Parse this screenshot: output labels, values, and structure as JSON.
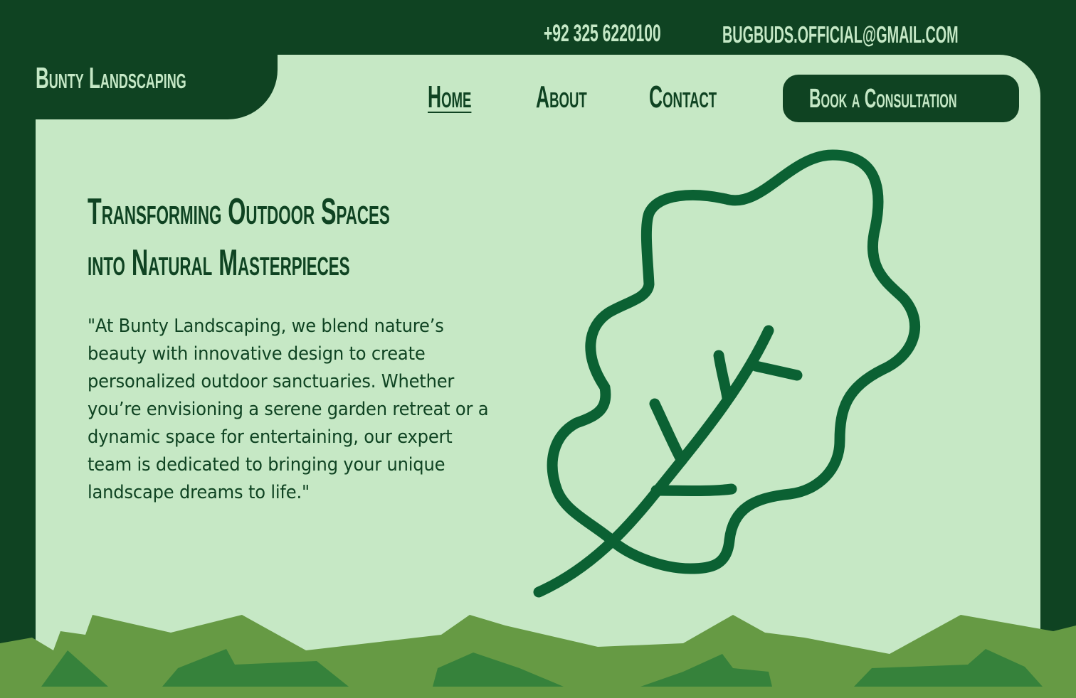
{
  "topbar": {
    "phone": "+92 325 6220100",
    "email": "bugbuds.official@gmail.com"
  },
  "brand": {
    "name": "Bunty Landscaping"
  },
  "nav": {
    "home": "Home",
    "about": "About",
    "contact": "Contact",
    "active": "Home"
  },
  "cta": {
    "label": "Book a Consultation"
  },
  "hero": {
    "headline_line1": "Transforming Outdoor Spaces",
    "headline_line2": "into Natural Masterpieces",
    "body": "\"At Bunty Landscaping, we blend nature’s beauty with innovative design to create personalized outdoor sanctuaries. Whether you’re envisioning a serene garden retreat or a dynamic space for entertaining, our expert team is dedicated to bringing your unique landscape dreams to life.\""
  },
  "icons": {
    "hero_illustration": "leaf-outline-icon"
  },
  "colors": {
    "dark_green": "#0f4322",
    "panel_mint": "#c6e8c5",
    "leaf_stroke": "#0b6133",
    "hill_light": "#669a44",
    "hill_dark": "#36823b"
  }
}
